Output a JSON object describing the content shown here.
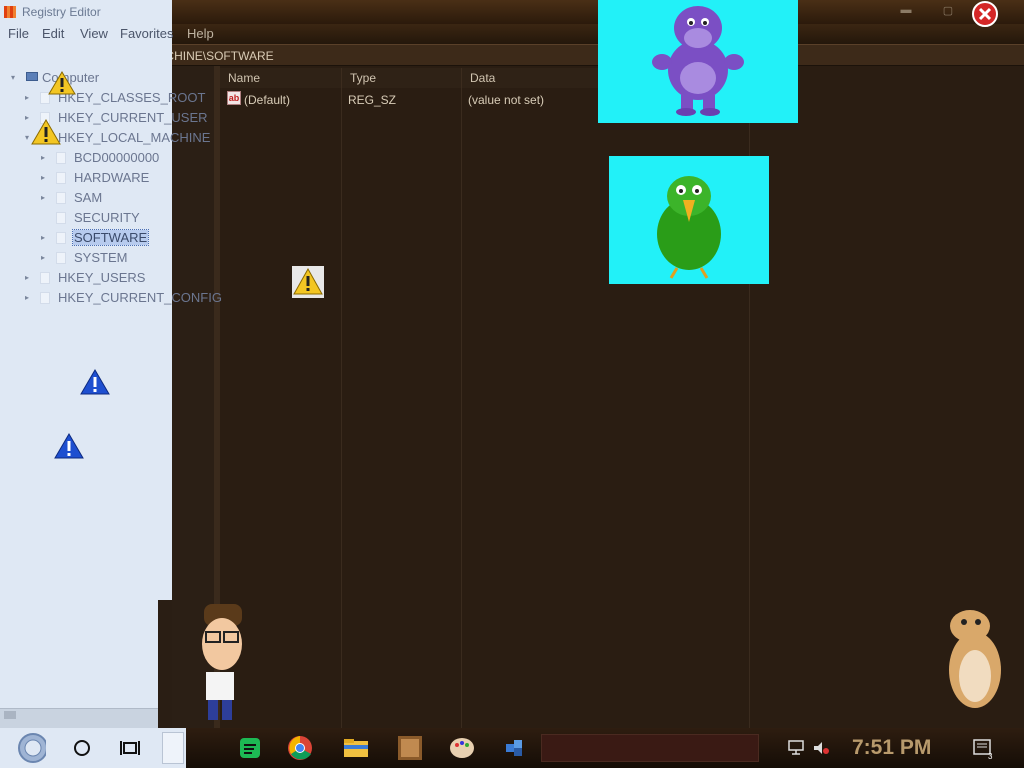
{
  "window": {
    "title": "Registry Editor",
    "address": "Computer\\HKEY_LOCAL_MACHINE\\SOFTWARE"
  },
  "menu": [
    "File",
    "Edit",
    "View",
    "Favorites",
    "Help"
  ],
  "tree": {
    "root": "Computer",
    "hives": [
      "HKEY_CLASSES_ROOT",
      "HKEY_CURRENT_USER",
      "HKEY_LOCAL_MACHINE",
      "HKEY_USERS",
      "HKEY_CURRENT_CONFIG"
    ],
    "hklm_children": [
      "BCD00000000",
      "HARDWARE",
      "SAM",
      "SECURITY",
      "SOFTWARE",
      "SYSTEM"
    ],
    "selected": "SOFTWARE"
  },
  "list": {
    "columns": [
      "Name",
      "Type",
      "Data"
    ],
    "rows": [
      {
        "name": "(Default)",
        "type": "REG_SZ",
        "data": "(value not set)"
      }
    ]
  },
  "taskbar": {
    "clock": "7:51 PM",
    "notification_count": "3",
    "apps": [
      "start-icon",
      "cortana-icon",
      "task-view-icon",
      "spotify-icon",
      "chrome-icon",
      "file-explorer-icon",
      "winrar-icon",
      "paint-icon",
      "regedit-icon"
    ]
  },
  "colors": {
    "tree_bg": "#dfe8f4",
    "content_bg": "#2a1d12",
    "cyan_sprite_bg": "#22f1f8",
    "clock": "#b89a6c"
  }
}
